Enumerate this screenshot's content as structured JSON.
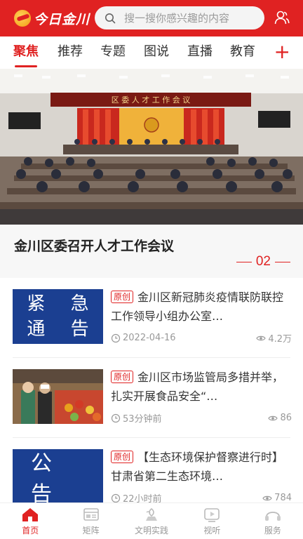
{
  "header": {
    "logo_text": "今日金川",
    "search_placeholder": "搜一搜你感兴趣的内容"
  },
  "tabs": [
    {
      "label": "聚焦",
      "active": true
    },
    {
      "label": "推荐",
      "active": false
    },
    {
      "label": "专题",
      "active": false
    },
    {
      "label": "图说",
      "active": false
    },
    {
      "label": "直播",
      "active": false
    },
    {
      "label": "教育",
      "active": false
    }
  ],
  "tab_add_label": "+",
  "hero": {
    "banner_text": "区 委 人 才 工 作 会 议",
    "title": "金川区委召开人才工作会议",
    "page_number": "02"
  },
  "news": [
    {
      "badge": "原创",
      "title": "金川区新冠肺炎疫情联防联控工作领导小组办公室…",
      "time": "2022-04-16",
      "views": "4.2万",
      "thumb_text_line1": "紧 急",
      "thumb_text_line2": "通 告"
    },
    {
      "badge": "原创",
      "title": "金川区市场监管局多措并举，扎实开展食品安全“…",
      "time": "53分钟前",
      "views": "86"
    },
    {
      "badge": "原创",
      "title": "【生态环境保护督察进行时】甘肃省第二生态环境…",
      "time": "22小时前",
      "views": "784",
      "thumb_text": "公 告"
    }
  ],
  "bottom_nav": [
    {
      "label": "首页",
      "icon": "home-icon",
      "active": true
    },
    {
      "label": "矩阵",
      "icon": "matrix-icon",
      "active": false
    },
    {
      "label": "文明实践",
      "icon": "civilization-icon",
      "active": false
    },
    {
      "label": "视听",
      "icon": "video-icon",
      "active": false
    },
    {
      "label": "服务",
      "icon": "service-icon",
      "active": false
    }
  ],
  "colors": {
    "brand_red": "#e02222",
    "notice_blue": "#1b3f91"
  }
}
